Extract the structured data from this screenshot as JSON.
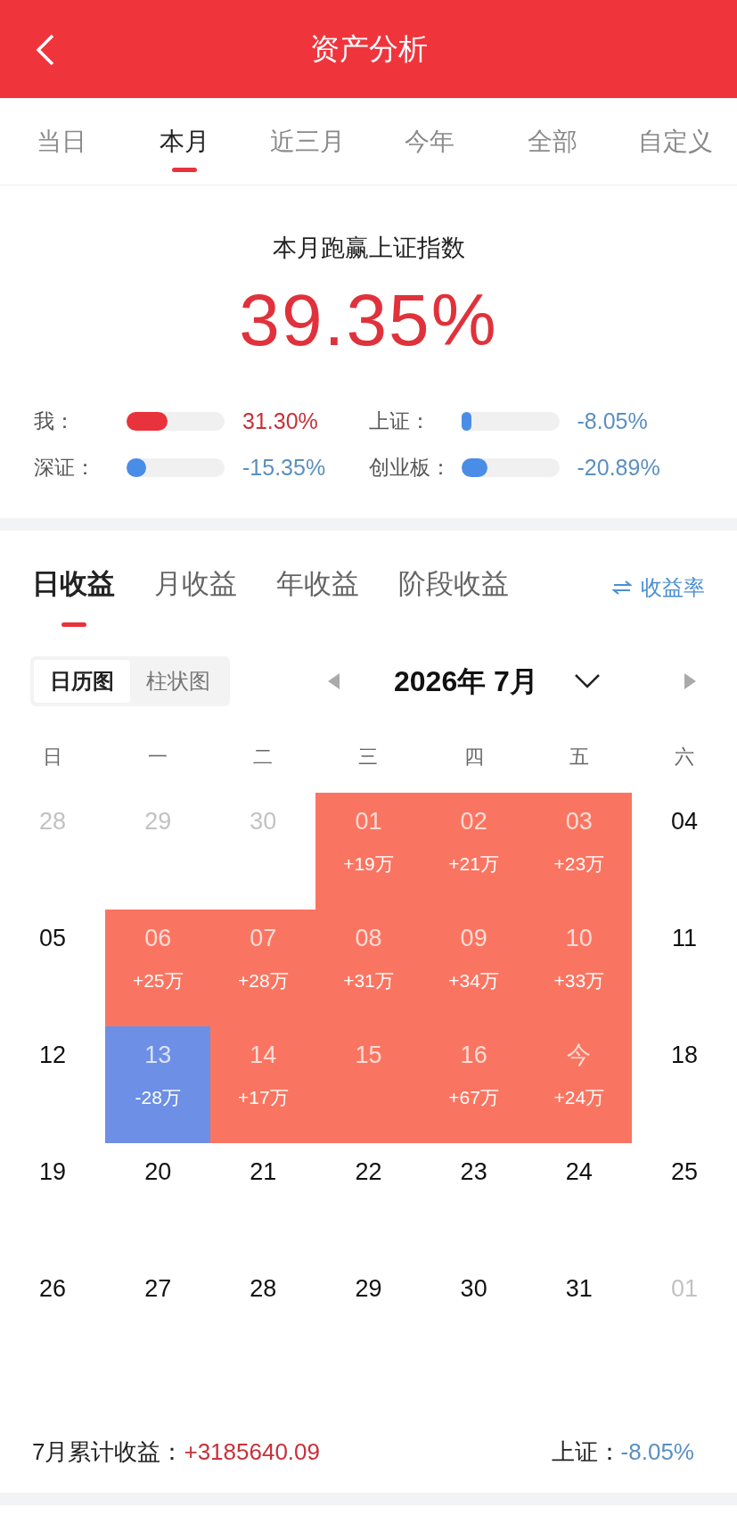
{
  "header": {
    "title": "资产分析"
  },
  "period_tabs": [
    {
      "label": "当日",
      "selected": false
    },
    {
      "label": "本月",
      "selected": true
    },
    {
      "label": "近三月",
      "selected": false
    },
    {
      "label": "今年",
      "selected": false
    },
    {
      "label": "全部",
      "selected": false
    },
    {
      "label": "自定义",
      "selected": false
    }
  ],
  "summary": {
    "title": "本月跑赢上证指数",
    "value": "39.35%",
    "comparisons": [
      {
        "label": "我：",
        "level": 0.42,
        "reading": "31.30%",
        "kind": "gain"
      },
      {
        "label": "上证：",
        "level": 0.1,
        "reading": "-8.05%",
        "kind": "loss"
      },
      {
        "label": "深证：",
        "level": 0.2,
        "reading": "-15.35%",
        "kind": "loss"
      },
      {
        "label": "创业板：",
        "level": 0.27,
        "reading": "-20.89%",
        "kind": "loss"
      }
    ]
  },
  "income_tabs": [
    {
      "label": "日收益",
      "selected": true
    },
    {
      "label": "月收益",
      "selected": false
    },
    {
      "label": "年收益",
      "selected": false
    },
    {
      "label": "阶段收益",
      "selected": false
    }
  ],
  "rate_link": "收益率",
  "view_toggle": [
    {
      "label": "日历图",
      "selected": true
    },
    {
      "label": "柱状图",
      "selected": false
    }
  ],
  "month": "2026年 7月",
  "weekdays": [
    "日",
    "一",
    "二",
    "三",
    "四",
    "五",
    "六"
  ],
  "weeks": [
    [
      {
        "day": "28",
        "kind": "other"
      },
      {
        "day": "29",
        "kind": "other"
      },
      {
        "day": "30",
        "kind": "other"
      },
      {
        "day": "01",
        "kind": "gain",
        "value": "+19万"
      },
      {
        "day": "02",
        "kind": "gain",
        "value": "+21万"
      },
      {
        "day": "03",
        "kind": "gain",
        "value": "+23万"
      },
      {
        "day": "04",
        "kind": "plain"
      }
    ],
    [
      {
        "day": "05",
        "kind": "plain"
      },
      {
        "day": "06",
        "kind": "gain",
        "value": "+25万"
      },
      {
        "day": "07",
        "kind": "gain",
        "value": "+28万"
      },
      {
        "day": "08",
        "kind": "gain",
        "value": "+31万"
      },
      {
        "day": "09",
        "kind": "gain",
        "value": "+34万"
      },
      {
        "day": "10",
        "kind": "gain",
        "value": "+33万"
      },
      {
        "day": "11",
        "kind": "plain"
      }
    ],
    [
      {
        "day": "12",
        "kind": "plain"
      },
      {
        "day": "13",
        "kind": "loss",
        "value": "-28万"
      },
      {
        "day": "14",
        "kind": "gain",
        "value": "+17万"
      },
      {
        "day": "15",
        "kind": "gain"
      },
      {
        "day": "16",
        "kind": "gain",
        "value": "+67万"
      },
      {
        "day": "今",
        "kind": "gain",
        "value": "+24万"
      },
      {
        "day": "18",
        "kind": "plain"
      }
    ],
    [
      {
        "day": "19",
        "kind": "plain"
      },
      {
        "day": "20",
        "kind": "plain"
      },
      {
        "day": "21",
        "kind": "plain"
      },
      {
        "day": "22",
        "kind": "plain"
      },
      {
        "day": "23",
        "kind": "plain"
      },
      {
        "day": "24",
        "kind": "plain"
      },
      {
        "day": "25",
        "kind": "plain"
      }
    ],
    [
      {
        "day": "26",
        "kind": "plain"
      },
      {
        "day": "27",
        "kind": "plain"
      },
      {
        "day": "28",
        "kind": "plain"
      },
      {
        "day": "29",
        "kind": "plain"
      },
      {
        "day": "30",
        "kind": "plain"
      },
      {
        "day": "31",
        "kind": "plain"
      },
      {
        "day": "01",
        "kind": "other"
      }
    ]
  ],
  "footer": {
    "total_label": "7月累计收益：",
    "total_value": "+3185640.09",
    "index_label": "上证：",
    "index_value": "-8.05%"
  }
}
